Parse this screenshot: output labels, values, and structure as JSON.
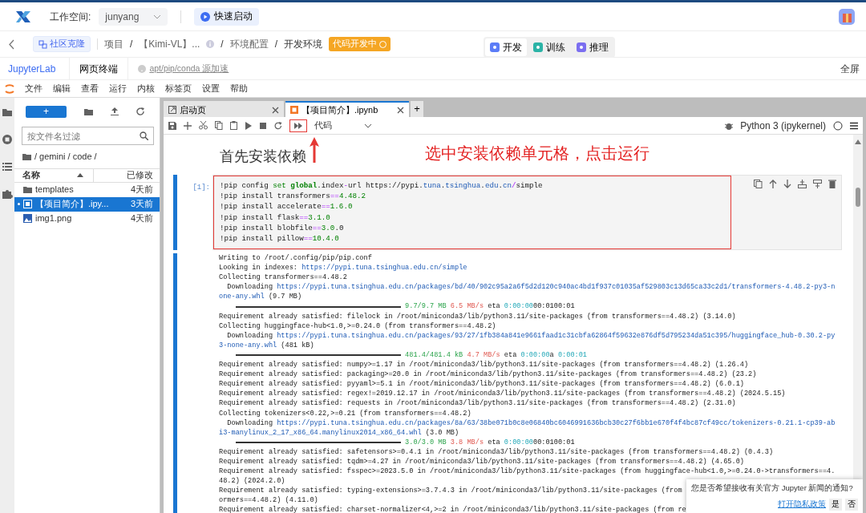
{
  "topbar": {
    "workspace_label": "工作空间:",
    "workspace": "junyang",
    "quick_start": "快速启动"
  },
  "breadcrumb": {
    "clone": "社区克隆",
    "items": [
      {
        "kind": "item",
        "text": "项目",
        "info": false
      },
      {
        "kind": "sep",
        "text": "/"
      },
      {
        "kind": "item",
        "text": "【Kimi-VL】...",
        "info": true
      },
      {
        "kind": "sep",
        "text": "/"
      },
      {
        "kind": "item",
        "text": "环境配置",
        "info": false
      },
      {
        "kind": "sep",
        "text": "/"
      },
      {
        "kind": "item",
        "text": "开发环境",
        "info": false
      }
    ],
    "status": "代码开发中"
  },
  "mode_tabs": [
    {
      "label": "开发",
      "selected": true,
      "color": "#5b7cf7"
    },
    {
      "label": "训练",
      "selected": false,
      "color": "#2bb3a6"
    },
    {
      "label": "推理",
      "selected": false,
      "color": "#7b6ef0"
    }
  ],
  "env_tabs": [
    {
      "label": "JupyterLab",
      "selected": true
    },
    {
      "label": "网页终端",
      "selected": false
    }
  ],
  "mirror_link": "apt/pip/conda 源加速",
  "fullscreen": "全屏",
  "menu": [
    "文件",
    "编辑",
    "查看",
    "运行",
    "内核",
    "标签页",
    "设置",
    "帮助"
  ],
  "file_browser": {
    "new_button": "+",
    "filter_placeholder": "按文件名过滤",
    "path": "/ gemini / code /",
    "columns": [
      "名称",
      "已修改"
    ],
    "files": [
      {
        "name": "templates",
        "modified": "4天前",
        "kind": "folder",
        "selected": false,
        "open": false
      },
      {
        "name": "【项目简介】.ipy...",
        "modified": "3天前",
        "kind": "notebook",
        "selected": true,
        "open": true
      },
      {
        "name": "img1.png",
        "modified": "4天前",
        "kind": "image",
        "selected": false,
        "open": false
      }
    ]
  },
  "doc_tabs": [
    {
      "label": "启动页",
      "kind": "launcher",
      "selected": false
    },
    {
      "label": "【项目简介】.ipynb",
      "kind": "notebook",
      "selected": true
    }
  ],
  "new_tab": "+",
  "cell_type": "代码",
  "kernel": "Python 3 (ipykernel)",
  "heading": "首先安装依赖",
  "annotation": "选中安装依赖单元格，点击运行",
  "cell": {
    "prompt": "[1]:",
    "code": [
      [
        {
          "kind": "plain",
          "text": "!pip config "
        },
        {
          "kind": "keyword",
          "text": "set "
        },
        {
          "kind": "builtin",
          "text": "global"
        },
        {
          "kind": "plain",
          "text": ".index"
        },
        {
          "kind": "operator",
          "text": "-"
        },
        {
          "kind": "plain",
          "text": "url https://pypi."
        },
        {
          "kind": "name",
          "text": "tuna"
        },
        {
          "kind": "plain",
          "text": "."
        },
        {
          "kind": "name",
          "text": "tsinghua"
        },
        {
          "kind": "plain",
          "text": "."
        },
        {
          "kind": "name",
          "text": "edu"
        },
        {
          "kind": "plain",
          "text": "."
        },
        {
          "kind": "name",
          "text": "cn"
        },
        {
          "kind": "operator",
          "text": "/"
        },
        {
          "kind": "plain",
          "text": "simple"
        }
      ],
      [
        {
          "kind": "plain",
          "text": "!pip install transformers"
        },
        {
          "kind": "operator",
          "text": "=="
        },
        {
          "kind": "number",
          "text": "4.48.2"
        }
      ],
      [
        {
          "kind": "plain",
          "text": "!pip install accelerate"
        },
        {
          "kind": "operator",
          "text": "=="
        },
        {
          "kind": "number",
          "text": "1.6.0"
        }
      ],
      [
        {
          "kind": "plain",
          "text": "!pip install flask"
        },
        {
          "kind": "operator",
          "text": "=="
        },
        {
          "kind": "number",
          "text": "3.1.0"
        }
      ],
      [
        {
          "kind": "plain",
          "text": "!pip install blobfile"
        },
        {
          "kind": "operator",
          "text": "=="
        },
        {
          "kind": "number",
          "text": "3.0"
        },
        {
          "kind": "plain",
          "text": ".0"
        }
      ],
      [
        {
          "kind": "plain",
          "text": "!pip install pillow"
        },
        {
          "kind": "operator",
          "text": "=="
        },
        {
          "kind": "number",
          "text": "10.4.0"
        }
      ]
    ]
  },
  "output": [
    [
      {
        "kind": "plain",
        "text": "Writing to /root/.config/pip/pip.conf"
      }
    ],
    [
      {
        "kind": "plain",
        "text": "Looking in indexes: "
      },
      {
        "kind": "link",
        "text": "https://pypi.tuna.tsinghua.edu.cn/simple"
      }
    ],
    [
      {
        "kind": "plain",
        "text": "Collecting transformers==4.48.2"
      }
    ],
    [
      {
        "kind": "plain",
        "text": "  Downloading "
      },
      {
        "kind": "link",
        "text": "https://pypi.tuna.tsinghua.edu.cn/packages/bd/40/902c95a2a6f5d2d120c940ac4bd1f937c01035af529803c13d65ca33c2d1/transformers-4.48.2-py3-n"
      }
    ],
    [
      {
        "kind": "link",
        "text": "one-any.whl"
      },
      {
        "kind": "plain",
        "text": " (9.7 MB)"
      }
    ],
    [
      {
        "kind": "bar",
        "level": 1
      },
      {
        "kind": "green",
        "text": "9.7/9.7 MB "
      },
      {
        "kind": "red",
        "text": "6.5 MB/s"
      },
      {
        "kind": "plain",
        "text": " eta "
      },
      {
        "kind": "cyan",
        "text": "0:00:00"
      },
      {
        "kind": "plain",
        "text": "00:0100:01"
      }
    ],
    [
      {
        "kind": "plain",
        "text": "Requirement already satisfied: filelock in /root/miniconda3/lib/python3.11/site-packages (from transformers==4.48.2) (3.14.0)"
      }
    ],
    [
      {
        "kind": "plain",
        "text": "Collecting huggingface-hub<1.0,>=0.24.0 (from transformers==4.48.2)"
      }
    ],
    [
      {
        "kind": "plain",
        "text": "  Downloading "
      },
      {
        "kind": "link",
        "text": "https://pypi.tuna.tsinghua.edu.cn/packages/93/27/1fb384a841e9661faad1c31cbfa62864f59632e876df5d795234da51c395/huggingface_hub-0.30.2-py"
      }
    ],
    [
      {
        "kind": "link",
        "text": "3-none-any.whl"
      },
      {
        "kind": "plain",
        "text": " (481 kB)"
      }
    ],
    [
      {
        "kind": "bar",
        "level": 1
      },
      {
        "kind": "green",
        "text": "481.4/481.4 kB "
      },
      {
        "kind": "red",
        "text": "4.7 MB/s"
      },
      {
        "kind": "plain",
        "text": " eta "
      },
      {
        "kind": "cyan",
        "text": "0:00:00"
      },
      {
        "kind": "plain",
        "text": "a "
      },
      {
        "kind": "cyan",
        "text": "0:00:01"
      }
    ],
    [
      {
        "kind": "plain",
        "text": "Requirement already satisfied: numpy>=1.17 in /root/miniconda3/lib/python3.11/site-packages (from transformers==4.48.2) (1.26.4)"
      }
    ],
    [
      {
        "kind": "plain",
        "text": "Requirement already satisfied: packaging>=20.0 in /root/miniconda3/lib/python3.11/site-packages (from transformers==4.48.2) (23.2)"
      }
    ],
    [
      {
        "kind": "plain",
        "text": "Requirement already satisfied: pyyaml>=5.1 in /root/miniconda3/lib/python3.11/site-packages (from transformers==4.48.2) (6.0.1)"
      }
    ],
    [
      {
        "kind": "plain",
        "text": "Requirement already satisfied: regex!=2019.12.17 in /root/miniconda3/lib/python3.11/site-packages (from transformers==4.48.2) (2024.5.15)"
      }
    ],
    [
      {
        "kind": "plain",
        "text": "Requirement already satisfied: requests in /root/miniconda3/lib/python3.11/site-packages (from transformers==4.48.2) (2.31.0)"
      }
    ],
    [
      {
        "kind": "plain",
        "text": "Collecting tokenizers<0.22,>=0.21 (from transformers==4.48.2)"
      }
    ],
    [
      {
        "kind": "plain",
        "text": "  Downloading "
      },
      {
        "kind": "link",
        "text": "https://pypi.tuna.tsinghua.edu.cn/packages/8a/63/38be071b0c8e06840bc6046991636bcb30c27f6bb1e670f4f4bc87cf49cc/tokenizers-0.21.1-cp39-ab"
      }
    ],
    [
      {
        "kind": "link",
        "text": "i3-manylinux_2_17_x86_64.manylinux2014_x86_64.whl"
      },
      {
        "kind": "plain",
        "text": " (3.0 MB)"
      }
    ],
    [
      {
        "kind": "bar",
        "level": 1
      },
      {
        "kind": "green",
        "text": "3.0/3.0 MB "
      },
      {
        "kind": "red",
        "text": "3.8 MB/s"
      },
      {
        "kind": "plain",
        "text": " eta "
      },
      {
        "kind": "cyan",
        "text": "0:00:00"
      },
      {
        "kind": "plain",
        "text": "00:0100:01"
      }
    ],
    [
      {
        "kind": "plain",
        "text": "Requirement already satisfied: safetensors>=0.4.1 in /root/miniconda3/lib/python3.11/site-packages (from transformers==4.48.2) (0.4.3)"
      }
    ],
    [
      {
        "kind": "plain",
        "text": "Requirement already satisfied: tqdm>=4.27 in /root/miniconda3/lib/python3.11/site-packages (from transformers==4.48.2) (4.65.0)"
      }
    ],
    [
      {
        "kind": "plain",
        "text": "Requirement already satisfied: fsspec>=2023.5.0 in /root/miniconda3/lib/python3.11/site-packages (from huggingface-hub<1.0,>=0.24.0->transformers==4."
      }
    ],
    [
      {
        "kind": "plain",
        "text": "48.2) (2024.2.0)"
      }
    ],
    [
      {
        "kind": "plain",
        "text": "Requirement already satisfied: typing-extensions>=3.7.4.3 in /root/miniconda3/lib/python3.11/site-packages (from"
      }
    ],
    [
      {
        "kind": "plain",
        "text": "ormers==4.48.2) (4.11.0)"
      }
    ],
    [
      {
        "kind": "plain",
        "text": "Requirement already satisfied: charset-normalizer<4,>=2 in /root/miniconda3/lib/python3.11/site-packages (from re"
      }
    ]
  ],
  "notification": {
    "text": "您是否希望接收有关官方 Jupyter 新闻的通知?",
    "link": "打开隐私政策",
    "buttons": [
      "是",
      "否"
    ]
  }
}
